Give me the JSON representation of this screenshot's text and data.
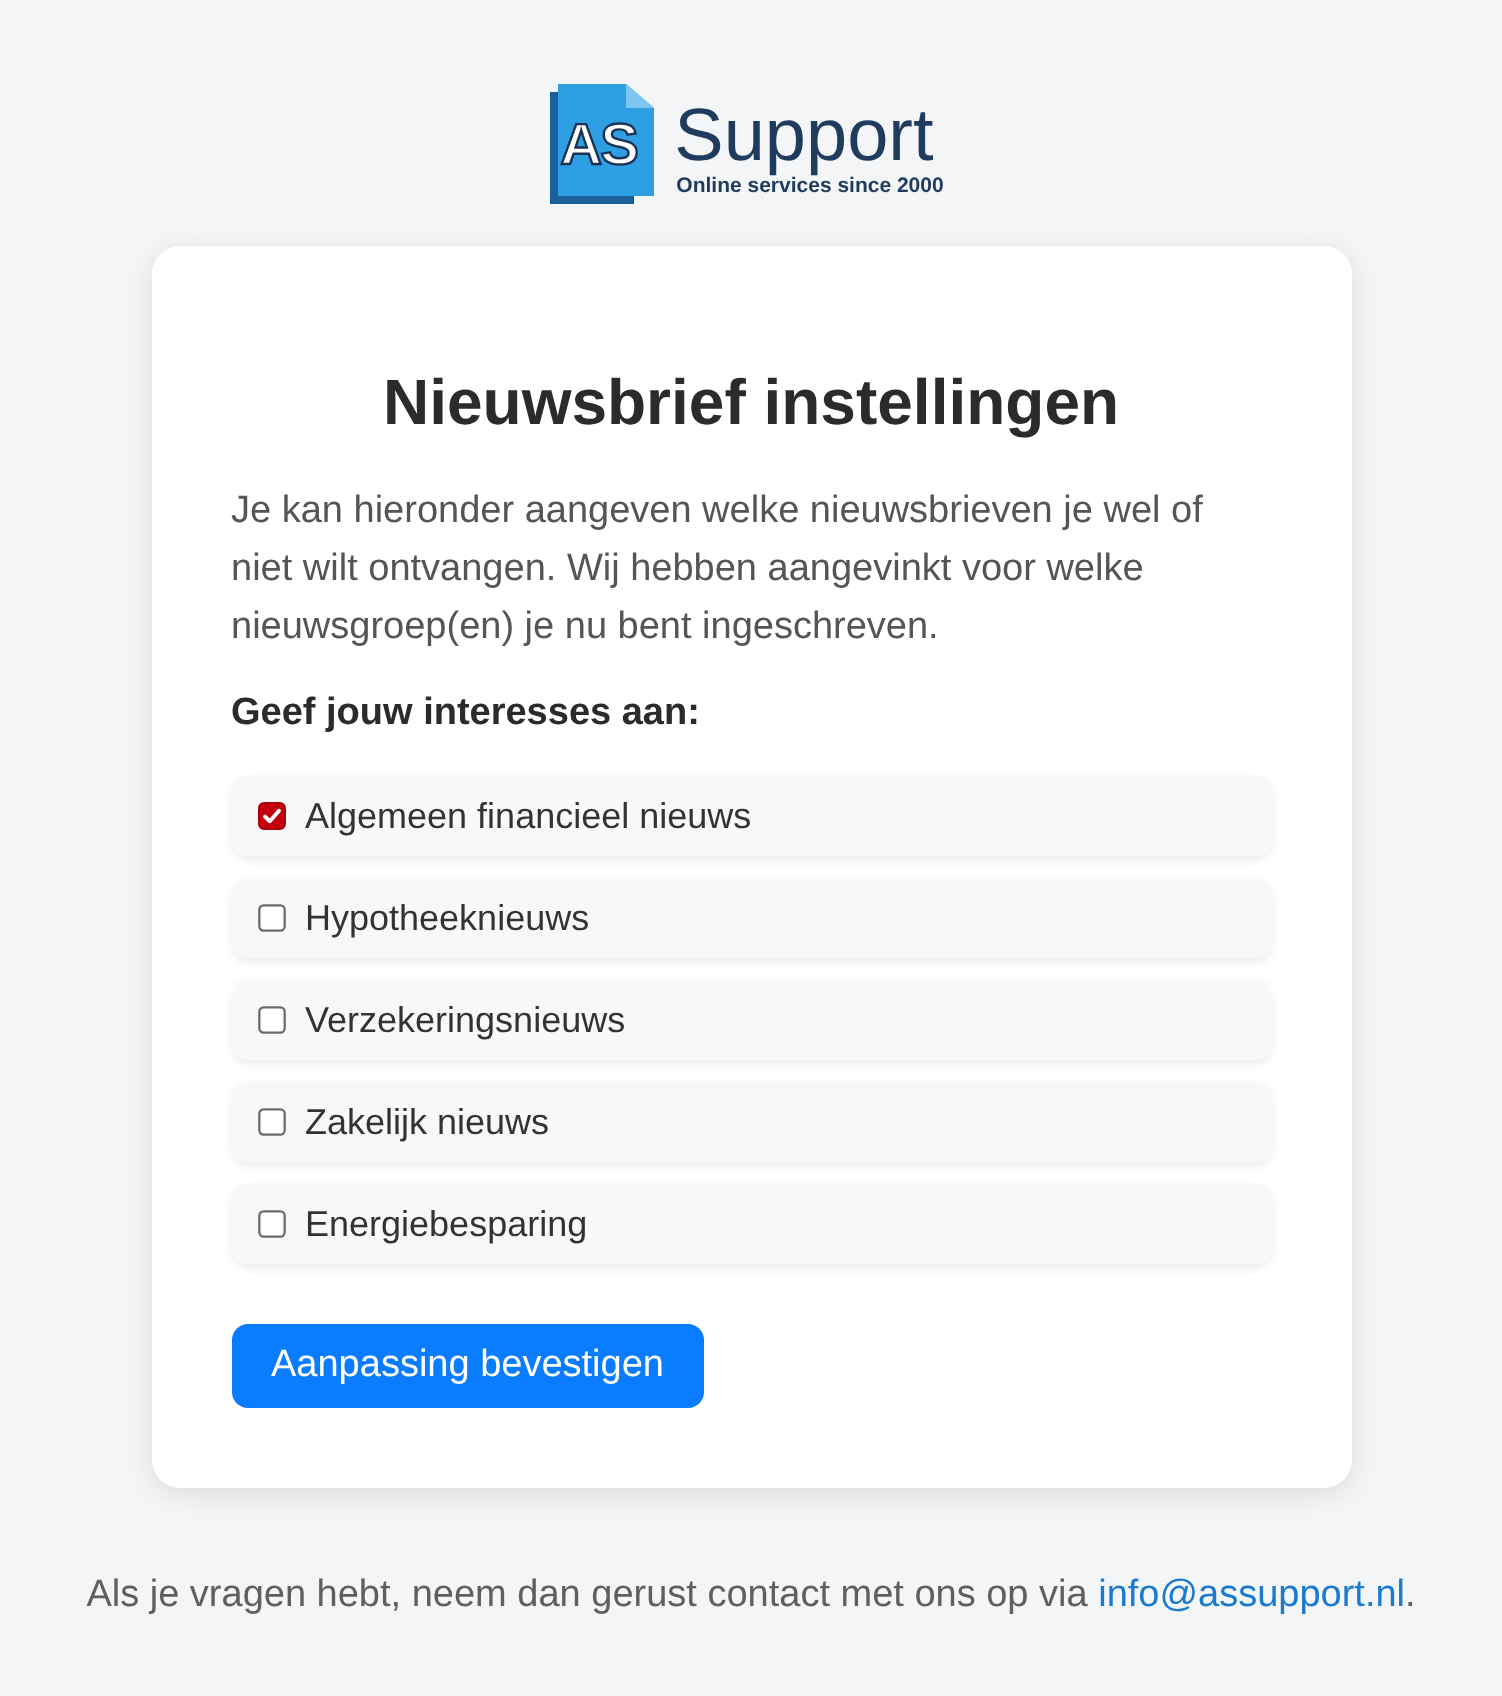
{
  "logo": {
    "mark": "AS",
    "name": "Support",
    "tagline": "Online services since 2000"
  },
  "card": {
    "title": "Nieuwsbrief instellingen",
    "intro": "Je kan hieronder aangeven welke nieuwsbrieven je wel of niet wilt ontvangen. Wij hebben aangevinkt voor welke nieuwsgroep(en) je nu bent ingeschreven.",
    "prompt": "Geef jouw interesses aan:",
    "options": [
      {
        "label": "Algemeen financieel nieuws",
        "checked": true
      },
      {
        "label": "Hypotheeknieuws",
        "checked": false
      },
      {
        "label": "Verzekeringsnieuws",
        "checked": false
      },
      {
        "label": "Zakelijk nieuws",
        "checked": false
      },
      {
        "label": "Energiebesparing",
        "checked": false
      }
    ],
    "submit": "Aanpassing bevestigen"
  },
  "footer": {
    "text_before": "Als je vragen hebt, neem dan gerust contact met ons op via",
    "link": "info@assupport.nl",
    "text_after": "."
  }
}
